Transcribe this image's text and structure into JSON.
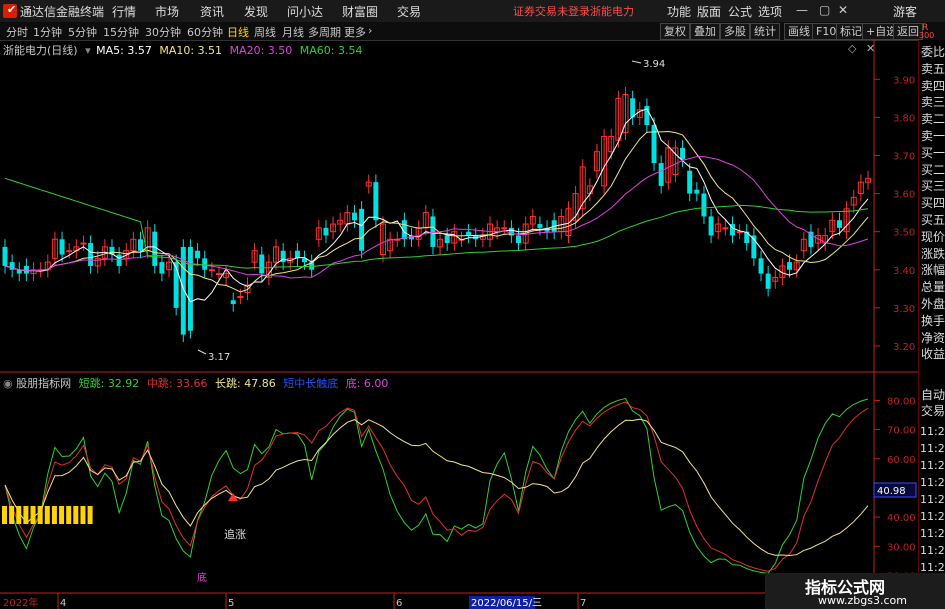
{
  "app": {
    "name": "通达信金融终端",
    "menus": [
      "行情",
      "市场",
      "资讯",
      "发现",
      "问小达",
      "财富圈",
      "交易"
    ],
    "warning": "证券交易未登录",
    "stock_name_title": "浙能电力",
    "right_menus": [
      "功能",
      "版面",
      "公式",
      "选项"
    ],
    "guest": "游客"
  },
  "toolbar": {
    "periods": [
      "分时",
      "1分钟",
      "5分钟",
      "15分钟",
      "30分钟",
      "60分钟",
      "日线",
      "周线",
      "月线",
      "多周期",
      "更多"
    ],
    "active_period": "日线",
    "right_buttons": [
      "复权",
      "叠加",
      "多股",
      "统计",
      "画线",
      "F10",
      "标记",
      "+自选",
      "返回"
    ]
  },
  "main_chart": {
    "label": "浙能电力(日线)",
    "ma": [
      {
        "name": "MA5",
        "value": "3.57",
        "color": "#ffffff"
      },
      {
        "name": "MA10",
        "value": "3.51",
        "color": "#f0e68c"
      },
      {
        "name": "MA20",
        "value": "3.50",
        "color": "#e040e0"
      },
      {
        "name": "MA60",
        "value": "3.54",
        "color": "#30d030"
      }
    ],
    "y_ticks": [
      "3.90",
      "3.80",
      "3.70",
      "3.60",
      "3.50",
      "3.40",
      "3.30",
      "3.20"
    ],
    "high_label": "3.94",
    "low_label": "3.17"
  },
  "chart_data": {
    "type": "candlestick",
    "ylim": [
      3.15,
      3.99
    ],
    "opens": [
      3.46,
      3.42,
      3.4,
      3.41,
      3.39,
      3.4,
      3.4,
      3.43,
      3.48,
      3.45,
      3.45,
      3.47,
      3.47,
      3.41,
      3.43,
      3.46,
      3.44,
      3.43,
      3.45,
      3.48,
      3.45,
      3.5,
      3.42,
      3.4,
      3.42,
      3.46,
      3.46,
      3.45,
      3.43,
      3.4,
      3.39,
      3.38,
      3.32,
      3.33,
      3.34,
      3.42,
      3.44,
      3.38,
      3.42,
      3.45,
      3.42,
      3.45,
      3.43,
      3.42,
      3.48,
      3.51,
      3.5,
      3.52,
      3.52,
      3.55,
      3.56,
      3.62,
      3.63,
      3.44,
      3.45,
      3.48,
      3.53,
      3.49,
      3.48,
      3.51,
      3.54,
      3.46,
      3.49,
      3.47,
      3.48,
      3.5,
      3.49,
      3.48,
      3.48,
      3.5,
      3.51,
      3.51,
      3.49,
      3.47,
      3.52,
      3.52,
      3.51,
      3.53,
      3.5,
      3.49,
      3.53,
      3.56,
      3.6,
      3.66,
      3.62,
      3.71,
      3.74,
      3.76,
      3.85,
      3.8,
      3.83,
      3.78,
      3.68,
      3.63,
      3.65,
      3.72,
      3.66,
      3.61,
      3.6,
      3.54,
      3.5,
      3.51,
      3.52,
      3.5,
      3.5,
      3.49,
      3.43,
      3.39,
      3.37,
      3.38,
      3.42,
      3.4,
      3.45,
      3.5,
      3.47,
      3.47,
      3.5,
      3.53,
      3.5,
      3.57,
      3.6,
      3.63
    ],
    "closes": [
      3.41,
      3.4,
      3.39,
      3.39,
      3.4,
      3.4,
      3.42,
      3.48,
      3.44,
      3.45,
      3.46,
      3.47,
      3.41,
      3.43,
      3.46,
      3.44,
      3.41,
      3.45,
      3.48,
      3.45,
      3.51,
      3.41,
      3.39,
      3.42,
      3.3,
      3.23,
      3.24,
      3.43,
      3.4,
      3.4,
      3.39,
      3.39,
      3.31,
      3.33,
      3.36,
      3.45,
      3.39,
      3.42,
      3.46,
      3.42,
      3.43,
      3.43,
      3.42,
      3.4,
      3.51,
      3.49,
      3.52,
      3.53,
      3.55,
      3.53,
      3.45,
      3.63,
      3.53,
      3.52,
      3.48,
      3.48,
      3.48,
      3.48,
      3.51,
      3.55,
      3.46,
      3.48,
      3.47,
      3.5,
      3.48,
      3.49,
      3.48,
      3.49,
      3.52,
      3.51,
      3.51,
      3.49,
      3.47,
      3.52,
      3.54,
      3.51,
      3.5,
      3.5,
      3.54,
      3.56,
      3.6,
      3.67,
      3.62,
      3.71,
      3.75,
      3.75,
      3.85,
      3.86,
      3.8,
      3.82,
      3.78,
      3.68,
      3.62,
      3.72,
      3.72,
      3.69,
      3.6,
      3.6,
      3.54,
      3.49,
      3.52,
      3.51,
      3.49,
      3.5,
      3.47,
      3.43,
      3.39,
      3.35,
      3.38,
      3.41,
      3.4,
      3.42,
      3.48,
      3.46,
      3.49,
      3.49,
      3.53,
      3.51,
      3.56,
      3.59,
      3.63,
      3.64
    ]
  },
  "indicator": {
    "label": "股朋指标网",
    "items": [
      {
        "name": "短跳",
        "value": "32.92",
        "color": "#30d030"
      },
      {
        "name": "中跳",
        "value": "33.66",
        "color": "#e03030"
      },
      {
        "name": "长跳",
        "value": "47.86",
        "color": "#f0e68c"
      },
      {
        "name": "短中长触底",
        "value": "",
        "color": "#2050ff"
      },
      {
        "name": "底",
        "value": "6.00",
        "color": "#e040e0"
      }
    ],
    "y_ticks": [
      "80.00",
      "70.00",
      "60.00",
      "50.00",
      "40.00",
      "30.00",
      "20.00"
    ],
    "current_value": "40.98",
    "annotation_up": "追涨",
    "annotation_bottom": "底"
  },
  "x_axis": {
    "labels": [
      "2022年",
      "4",
      "5",
      "6",
      "7"
    ],
    "cursor_date": "2022/06/15/三"
  },
  "side_panel": {
    "items": [
      "委比",
      "卖五",
      "卖四",
      "卖三",
      "卖二",
      "卖一",
      "买一",
      "买二",
      "买三",
      "买四",
      "买五",
      "现价",
      "涨跌",
      "涨幅",
      "总量",
      "外盘",
      "换手",
      "净资",
      "收益"
    ],
    "trade_labels": [
      "自动",
      "交易"
    ],
    "times": [
      "11:26",
      "11:26",
      "11:26",
      "11:26",
      "11:27",
      "11:27",
      "11:27",
      "11:27",
      "11:27"
    ],
    "top_badge": "R",
    "top_num": "300"
  },
  "watermark": {
    "title": "指标公式网",
    "url": "www.zbgs3.com"
  },
  "colors": {
    "up": "#ff3030",
    "down": "#00e0e0",
    "grid": "#600000",
    "axis": "#c02020"
  }
}
